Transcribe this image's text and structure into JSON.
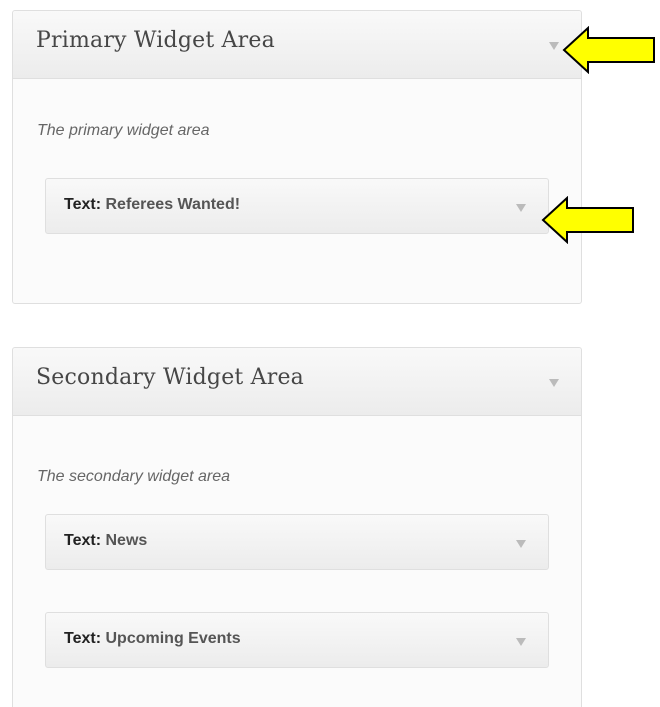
{
  "sidebars": [
    {
      "title": "Primary Widget Area",
      "description": "The primary widget area",
      "widgets": [
        {
          "type": "Text:",
          "name": "Referees Wanted!"
        }
      ]
    },
    {
      "title": "Secondary Widget Area",
      "description": "The secondary widget area",
      "widgets": [
        {
          "type": "Text:",
          "name": "News"
        },
        {
          "type": "Text:",
          "name": "Upcoming Events"
        }
      ]
    }
  ],
  "icons": {
    "toggle": "triangle-down-icon",
    "callout": "arrow-left-icon"
  },
  "colors": {
    "callout_fill": "#ffff00",
    "callout_stroke": "#000000",
    "header_text": "#464646",
    "border": "#dfdfdf"
  }
}
